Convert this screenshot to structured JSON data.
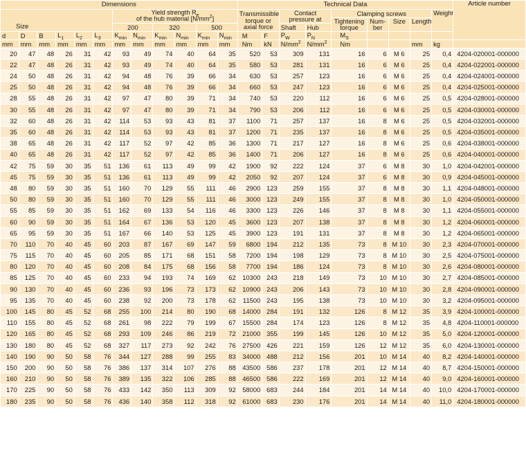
{
  "header": {
    "dimensions": "Dimensions",
    "technical_data": "Technical Data",
    "article_number": "Article number",
    "yield_line1": "Yield strength R",
    "yield_sub": "e",
    "yield_line2": "of the hub material [N/mm",
    "yield_sup": "2",
    "yield_end": "]",
    "g200": "200",
    "g320": "320",
    "g500": "500",
    "size": "Size",
    "torque_line1": "Transmissible",
    "torque_line2": "torque or",
    "torque_line3": "axial force",
    "contact_line1": "Contact",
    "contact_line2": "pressure at",
    "shaft": "Shaft",
    "hub": "Hub",
    "clamping": "Clamping screws",
    "tightening_line1": "Tightening",
    "tightening_line2": "torque",
    "number_line1": "Num-",
    "number_line2": "ber",
    "screw_size": "Size",
    "length": "Length",
    "weight": "Weight",
    "col_d": "d",
    "col_D": "D",
    "col_B": "B",
    "col_L": "L",
    "sub1": "1",
    "sub2": "2",
    "sub3": "3",
    "col_K": "K",
    "col_N": "N",
    "sub_min": "min",
    "col_M": "M",
    "col_F": "F",
    "col_P": "P",
    "sub_W": "W",
    "sub_N": "N",
    "col_Ms": "M",
    "sub_S": "S",
    "u_mm": "mm",
    "u_Nm": "Nm",
    "u_kN": "kN",
    "u_Nmm": "N/mm",
    "u_sup2": "2",
    "u_kg": "kg"
  },
  "rows": [
    [
      "20",
      "47",
      "48",
      "26",
      "31",
      "42",
      "93",
      "49",
      "74",
      "40",
      "64",
      "35",
      "520",
      "53",
      "309",
      "131",
      "16",
      "6",
      "M 6",
      "25",
      "0,4",
      "4204-020001-000000"
    ],
    [
      "22",
      "47",
      "48",
      "26",
      "31",
      "42",
      "93",
      "49",
      "74",
      "40",
      "64",
      "35",
      "580",
      "53",
      "281",
      "131",
      "16",
      "6",
      "M 6",
      "25",
      "0,4",
      "4204-022001-000000"
    ],
    [
      "24",
      "50",
      "48",
      "26",
      "31",
      "42",
      "94",
      "48",
      "76",
      "39",
      "66",
      "34",
      "630",
      "53",
      "257",
      "123",
      "16",
      "6",
      "M 6",
      "25",
      "0,4",
      "4204-024001-000000"
    ],
    [
      "25",
      "50",
      "48",
      "26",
      "31",
      "42",
      "94",
      "48",
      "76",
      "39",
      "66",
      "34",
      "660",
      "53",
      "247",
      "123",
      "16",
      "6",
      "M 6",
      "25",
      "0,4",
      "4204-025001-000000"
    ],
    [
      "28",
      "55",
      "48",
      "26",
      "31",
      "42",
      "97",
      "47",
      "80",
      "39",
      "71",
      "34",
      "740",
      "53",
      "220",
      "112",
      "16",
      "6",
      "M 6",
      "25",
      "0,5",
      "4204-028001-000000"
    ],
    [
      "30",
      "55",
      "48",
      "26",
      "31",
      "42",
      "97",
      "47",
      "80",
      "39",
      "71",
      "34",
      "790",
      "53",
      "206",
      "112",
      "16",
      "6",
      "M 6",
      "25",
      "0,5",
      "4204-030001-000000"
    ],
    [
      "32",
      "60",
      "48",
      "26",
      "31",
      "42",
      "114",
      "53",
      "93",
      "43",
      "81",
      "37",
      "1100",
      "71",
      "257",
      "137",
      "16",
      "8",
      "M 6",
      "25",
      "0,5",
      "4204-032001-000000"
    ],
    [
      "35",
      "60",
      "48",
      "26",
      "31",
      "42",
      "114",
      "53",
      "93",
      "43",
      "81",
      "37",
      "1200",
      "71",
      "235",
      "137",
      "16",
      "8",
      "M 6",
      "25",
      "0,5",
      "4204-035001-000000"
    ],
    [
      "38",
      "65",
      "48",
      "26",
      "31",
      "42",
      "117",
      "52",
      "97",
      "42",
      "85",
      "36",
      "1300",
      "71",
      "217",
      "127",
      "16",
      "8",
      "M 6",
      "25",
      "0,6",
      "4204-038001-000000"
    ],
    [
      "40",
      "65",
      "48",
      "26",
      "31",
      "42",
      "117",
      "52",
      "97",
      "42",
      "85",
      "36",
      "1400",
      "71",
      "206",
      "127",
      "16",
      "8",
      "M 6",
      "25",
      "0,6",
      "4204-040001-000000"
    ],
    [
      "42",
      "75",
      "59",
      "30",
      "35",
      "51",
      "136",
      "61",
      "113",
      "49",
      "99",
      "42",
      "1900",
      "92",
      "222",
      "124",
      "37",
      "6",
      "M 8",
      "30",
      "1,0",
      "4204-042001-000000"
    ],
    [
      "45",
      "75",
      "59",
      "30",
      "35",
      "51",
      "136",
      "61",
      "113",
      "49",
      "99",
      "42",
      "2050",
      "92",
      "207",
      "124",
      "37",
      "6",
      "M 8",
      "30",
      "0,9",
      "4204-045001-000000"
    ],
    [
      "48",
      "80",
      "59",
      "30",
      "35",
      "51",
      "160",
      "70",
      "129",
      "55",
      "111",
      "46",
      "2900",
      "123",
      "259",
      "155",
      "37",
      "8",
      "M 8",
      "30",
      "1,1",
      "4204-048001-000000"
    ],
    [
      "50",
      "80",
      "59",
      "30",
      "35",
      "51",
      "160",
      "70",
      "129",
      "55",
      "111",
      "46",
      "3000",
      "123",
      "249",
      "155",
      "37",
      "8",
      "M 8",
      "30",
      "1,0",
      "4204-050001-000000"
    ],
    [
      "55",
      "85",
      "59",
      "30",
      "35",
      "51",
      "162",
      "69",
      "133",
      "54",
      "116",
      "46",
      "3300",
      "123",
      "226",
      "146",
      "37",
      "8",
      "M 8",
      "30",
      "1,1",
      "4204-055001-000000"
    ],
    [
      "60",
      "90",
      "59",
      "30",
      "35",
      "51",
      "164",
      "67",
      "136",
      "53",
      "120",
      "45",
      "3600",
      "123",
      "207",
      "138",
      "37",
      "8",
      "M 8",
      "30",
      "1,2",
      "4204-060001-000000"
    ],
    [
      "65",
      "95",
      "59",
      "30",
      "35",
      "51",
      "167",
      "66",
      "140",
      "53",
      "125",
      "45",
      "3900",
      "123",
      "191",
      "131",
      "37",
      "8",
      "M 8",
      "30",
      "1,2",
      "4204-065001-000000"
    ],
    [
      "70",
      "110",
      "70",
      "40",
      "45",
      "60",
      "203",
      "87",
      "167",
      "69",
      "147",
      "59",
      "6800",
      "194",
      "212",
      "135",
      "73",
      "8",
      "M 10",
      "30",
      "2,3",
      "4204-070001-000000"
    ],
    [
      "75",
      "115",
      "70",
      "40",
      "45",
      "60",
      "205",
      "85",
      "171",
      "68",
      "151",
      "58",
      "7200",
      "194",
      "198",
      "129",
      "73",
      "8",
      "M 10",
      "30",
      "2,5",
      "4204-075001-000000"
    ],
    [
      "80",
      "120",
      "70",
      "40",
      "45",
      "60",
      "208",
      "84",
      "175",
      "68",
      "156",
      "58",
      "7700",
      "194",
      "186",
      "124",
      "73",
      "8",
      "M 10",
      "30",
      "2,6",
      "4204-080001-000000"
    ],
    [
      "85",
      "125",
      "70",
      "40",
      "45",
      "60",
      "233",
      "94",
      "193",
      "74",
      "169",
      "62",
      "10300",
      "243",
      "218",
      "149",
      "73",
      "10",
      "M 10",
      "30",
      "2,7",
      "4204-085001-000000"
    ],
    [
      "90",
      "130",
      "70",
      "40",
      "45",
      "60",
      "236",
      "93",
      "196",
      "73",
      "173",
      "62",
      "10900",
      "243",
      "206",
      "143",
      "73",
      "10",
      "M 10",
      "30",
      "2,8",
      "4204-090001-000000"
    ],
    [
      "95",
      "135",
      "70",
      "40",
      "45",
      "60",
      "238",
      "92",
      "200",
      "73",
      "178",
      "62",
      "11500",
      "243",
      "195",
      "138",
      "73",
      "10",
      "M 10",
      "30",
      "3,2",
      "4204-095001-000000"
    ],
    [
      "100",
      "145",
      "80",
      "45",
      "52",
      "68",
      "255",
      "100",
      "214",
      "80",
      "190",
      "68",
      "14000",
      "284",
      "191",
      "132",
      "126",
      "8",
      "M 12",
      "35",
      "3,9",
      "4204-100001-000000"
    ],
    [
      "110",
      "155",
      "80",
      "45",
      "52",
      "68",
      "261",
      "98",
      "222",
      "79",
      "199",
      "67",
      "15500",
      "284",
      "174",
      "123",
      "126",
      "8",
      "M 12",
      "35",
      "4,8",
      "4204-110001-000000"
    ],
    [
      "120",
      "165",
      "80",
      "45",
      "52",
      "68",
      "293",
      "109",
      "246",
      "86",
      "219",
      "72",
      "21000",
      "355",
      "199",
      "145",
      "126",
      "10",
      "M 12",
      "35",
      "5,0",
      "4204-120001-000000"
    ],
    [
      "130",
      "180",
      "80",
      "45",
      "52",
      "68",
      "327",
      "117",
      "273",
      "92",
      "242",
      "76",
      "27500",
      "426",
      "221",
      "159",
      "126",
      "12",
      "M 12",
      "35",
      "6,0",
      "4204-130001-000000"
    ],
    [
      "140",
      "190",
      "90",
      "50",
      "58",
      "76",
      "344",
      "127",
      "288",
      "99",
      "255",
      "83",
      "34000",
      "488",
      "212",
      "156",
      "201",
      "10",
      "M 14",
      "40",
      "8,2",
      "4204-140001-000000"
    ],
    [
      "150",
      "200",
      "90",
      "50",
      "58",
      "76",
      "386",
      "137",
      "314",
      "107",
      "276",
      "88",
      "43500",
      "586",
      "237",
      "178",
      "201",
      "12",
      "M 14",
      "40",
      "8,7",
      "4204-150001-000000"
    ],
    [
      "160",
      "210",
      "90",
      "50",
      "58",
      "76",
      "389",
      "135",
      "322",
      "106",
      "285",
      "88",
      "46500",
      "586",
      "222",
      "169",
      "201",
      "12",
      "M 14",
      "40",
      "9,0",
      "4204-160001-000000"
    ],
    [
      "170",
      "225",
      "90",
      "50",
      "58",
      "76",
      "433",
      "142",
      "350",
      "113",
      "309",
      "92",
      "58000",
      "683",
      "244",
      "184",
      "201",
      "14",
      "M 14",
      "40",
      "10,0",
      "4204-170001-000000"
    ],
    [
      "180",
      "235",
      "90",
      "50",
      "58",
      "76",
      "436",
      "140",
      "358",
      "112",
      "318",
      "92",
      "61000",
      "683",
      "230",
      "176",
      "201",
      "14",
      "M 14",
      "40",
      "11,0",
      "4204-180001-000000"
    ]
  ]
}
